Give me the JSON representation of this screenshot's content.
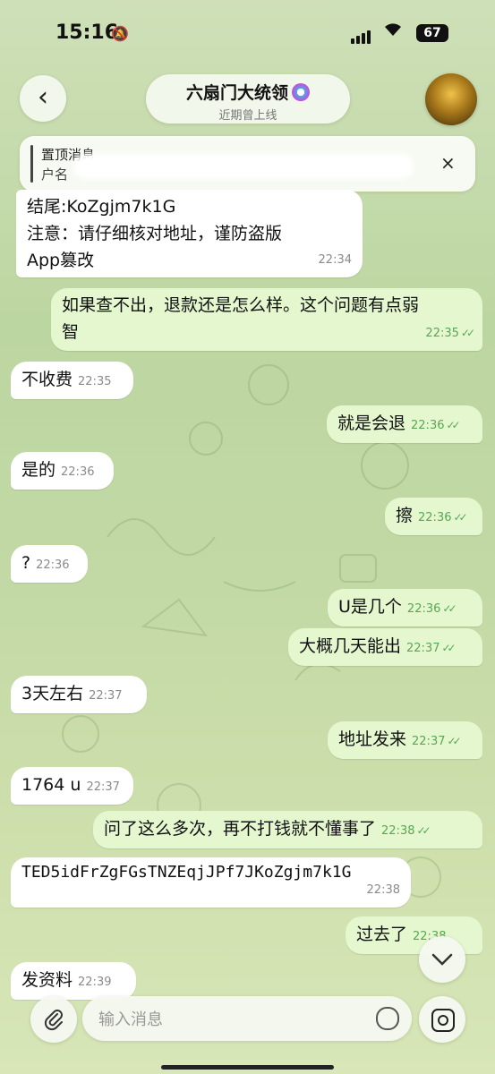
{
  "status_bar": {
    "time": "15:16",
    "battery": "67"
  },
  "header": {
    "back_label": "‹",
    "title": "六扇门大统领",
    "subtitle": "近期曾上线"
  },
  "pinned": {
    "title": "置顶消息",
    "text": "户名",
    "close_label": "×"
  },
  "messages": [
    {
      "dir": "in",
      "lines": [
        "结尾:KoZgjm7k1G",
        "注意：请仔细核对地址，谨防盗版",
        "App篡改"
      ],
      "time": "22:34"
    },
    {
      "dir": "out",
      "lines": [
        "如果查不出，退款还是怎么样。这个问题有点弱",
        "智"
      ],
      "time": "22:35"
    },
    {
      "dir": "in",
      "text": "不收费",
      "time": "22:35"
    },
    {
      "dir": "out",
      "text": "就是会退",
      "time": "22:36"
    },
    {
      "dir": "in",
      "text": "是的",
      "time": "22:36"
    },
    {
      "dir": "out",
      "text": "擦",
      "time": "22:36"
    },
    {
      "dir": "in",
      "text": "?",
      "time": "22:36"
    },
    {
      "dir": "out",
      "text": "U是几个",
      "time": "22:36"
    },
    {
      "dir": "out",
      "text": "大概几天能出",
      "time": "22:37"
    },
    {
      "dir": "in",
      "text": "3天左右",
      "time": "22:37"
    },
    {
      "dir": "out",
      "text": "地址发来",
      "time": "22:37"
    },
    {
      "dir": "in",
      "text": "1764 u",
      "time": "22:37"
    },
    {
      "dir": "out",
      "text": "问了这么多次，再不打钱就不懂事了",
      "time": "22:38"
    },
    {
      "dir": "in",
      "text": "TED5idFrZgFGsTNZEqjJPf7JKoZgjm7k1G",
      "time": "22:38"
    },
    {
      "dir": "out",
      "text": "过去了",
      "time": "22:38"
    },
    {
      "dir": "in",
      "text": "发资料",
      "time": "22:39"
    }
  ],
  "composer": {
    "placeholder": "输入消息"
  },
  "icons": [
    "back-icon",
    "mute-bell-icon",
    "signal-icon",
    "wifi-icon",
    "battery-icon",
    "verified-badge-icon",
    "close-icon",
    "read-checks-icon",
    "scroll-down-icon",
    "paperclip-icon",
    "sticker-icon",
    "camera-icon"
  ]
}
